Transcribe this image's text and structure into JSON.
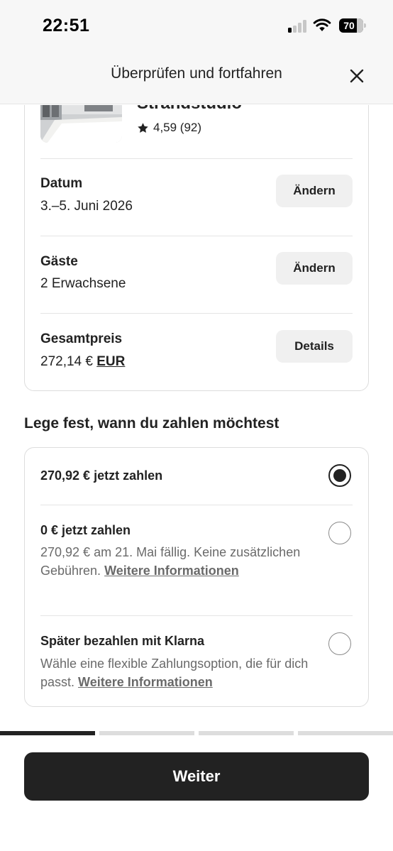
{
  "status_bar": {
    "time": "22:51",
    "battery": "70"
  },
  "header": {
    "title": "Überprüfen und fortfahren",
    "close_icon": "close-icon"
  },
  "listing": {
    "title": "Strandstudio",
    "rating": "4,59 (92)"
  },
  "trip": {
    "date": {
      "label": "Datum",
      "value": "3.–5. Juni 2026",
      "button": "Ändern"
    },
    "guests": {
      "label": "Gäste",
      "value": "2 Erwachsene",
      "button": "Ändern"
    },
    "total": {
      "label": "Gesamtpreis",
      "amount": "272,14 €",
      "currency": "EUR",
      "button": "Details"
    }
  },
  "payment": {
    "section_title": "Lege fest, wann du zahlen möchtest",
    "options": [
      {
        "title": "270,92 € jetzt zahlen",
        "selected": true
      },
      {
        "title": "0 € jetzt zahlen",
        "desc": "270,92 € am 21. Mai fällig. Keine zusätzlichen Gebühren.",
        "link": "Weitere Informationen",
        "selected": false
      },
      {
        "title": "Später bezahlen mit Klarna",
        "desc": "Wähle eine flexible Zahlungsoption, die für dich passt.",
        "link": "Weitere Informationen",
        "selected": false
      }
    ]
  },
  "progress": {
    "completed_steps": 1,
    "total_steps": 4
  },
  "footer": {
    "continue_label": "Weiter"
  },
  "colors": {
    "primary": "#222222",
    "muted_text": "#6a6a6a",
    "divider": "#dddddd"
  }
}
